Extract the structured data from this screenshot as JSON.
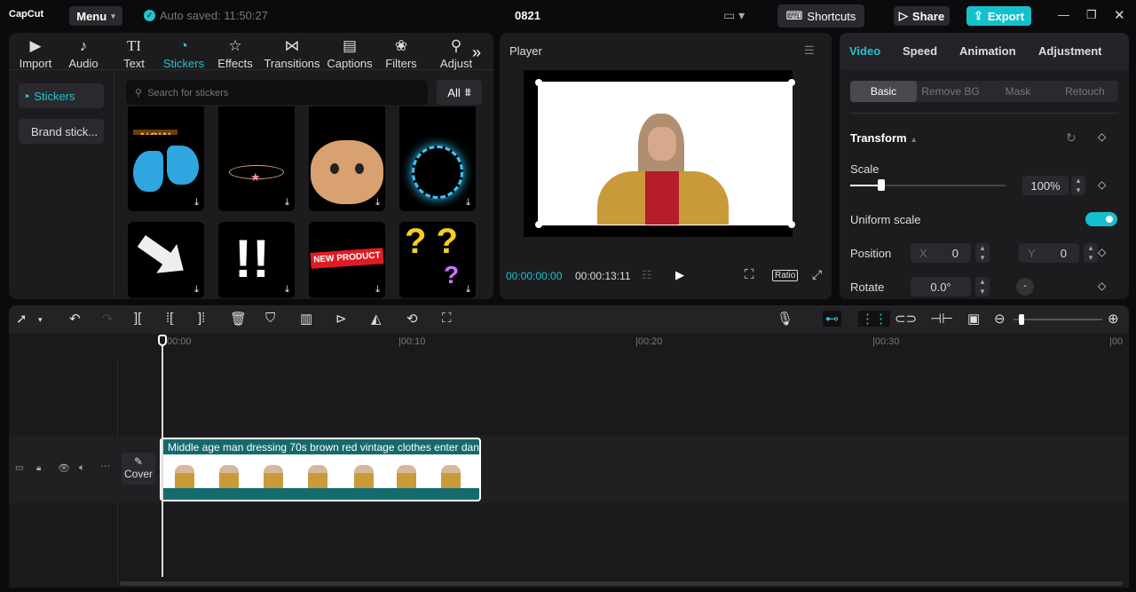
{
  "app": {
    "logo": "CapCut",
    "menu": "Menu",
    "autosave": "Auto saved: 11:50:27",
    "project": "0821",
    "shortcuts": "Shortcuts",
    "share": "Share",
    "export": "Export",
    "accent": "#22c3cf"
  },
  "tabs": [
    {
      "label": "Import",
      "icon": "import-icon"
    },
    {
      "label": "Audio",
      "icon": "audio-icon"
    },
    {
      "label": "Text",
      "icon": "text-icon"
    },
    {
      "label": "Stickers",
      "icon": "stickers-icon"
    },
    {
      "label": "Effects",
      "icon": "effects-icon"
    },
    {
      "label": "Transitions",
      "icon": "transitions-icon"
    },
    {
      "label": "Captions",
      "icon": "captions-icon"
    },
    {
      "label": "Filters",
      "icon": "filters-icon"
    },
    {
      "label": "Adjust",
      "icon": "adjust-icon"
    }
  ],
  "sidebar": {
    "items": [
      "Stickers",
      "Brand stick..."
    ]
  },
  "search": {
    "placeholder": "Search for stickers",
    "filter": "All"
  },
  "stickers": [
    "NEW PRODUCT"
  ],
  "player": {
    "title": "Player",
    "current": "00:00:00:00",
    "total": "00:00:13:11",
    "ratio": "Ratio"
  },
  "props": {
    "tabs": [
      "Video",
      "Speed",
      "Animation",
      "Adjustment"
    ],
    "subtabs": [
      "Basic",
      "Remove BG",
      "Mask",
      "Retouch"
    ],
    "section": "Transform",
    "scale_label": "Scale",
    "scale_value": "100%",
    "scale_fraction": 0.2,
    "uniform": "Uniform scale",
    "uniform_on": true,
    "position_label": "Position",
    "x_label": "X",
    "x": "0",
    "y_label": "Y",
    "y": "0",
    "rotate_label": "Rotate",
    "rotate": "0.0°"
  },
  "timeline": {
    "ruler": [
      "00:00",
      "|00:10",
      "|00:20",
      "|00:30",
      "|00"
    ],
    "clip_title": "Middle age man dressing 70s brown red vintage clothes enter dan",
    "cover": "Cover"
  }
}
